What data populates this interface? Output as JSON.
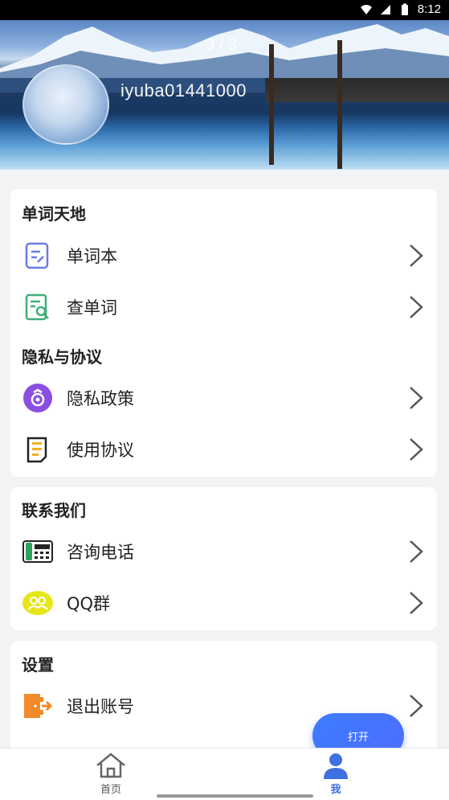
{
  "status_bar": {
    "time": "8:12"
  },
  "header": {
    "pager": "3 / 3",
    "username": "iyuba01441000"
  },
  "sections": [
    {
      "title": "单词天地",
      "items": [
        {
          "label": "单词本",
          "icon": "wordbook-icon"
        },
        {
          "label": "查单词",
          "icon": "search-word-icon"
        }
      ]
    },
    {
      "title": "隐私与协议",
      "items": [
        {
          "label": "隐私政策",
          "icon": "privacy-icon"
        },
        {
          "label": "使用协议",
          "icon": "agreement-icon"
        }
      ]
    },
    {
      "title": "联系我们",
      "items": [
        {
          "label": "咨询电话",
          "icon": "phone-icon"
        },
        {
          "label": "QQ群",
          "icon": "qq-group-icon"
        }
      ]
    },
    {
      "title": "设置",
      "items": [
        {
          "label": "退出账号",
          "icon": "logout-icon"
        }
      ]
    }
  ],
  "fab": {
    "label": "打开"
  },
  "tabbar": {
    "tabs": [
      {
        "label": "首页",
        "icon": "home-icon"
      },
      {
        "label": "我",
        "icon": "profile-icon",
        "active": true
      }
    ]
  },
  "colors": {
    "accent": "#3c7cff",
    "tab_active": "#3f6fe0",
    "chevron": "#555555"
  }
}
